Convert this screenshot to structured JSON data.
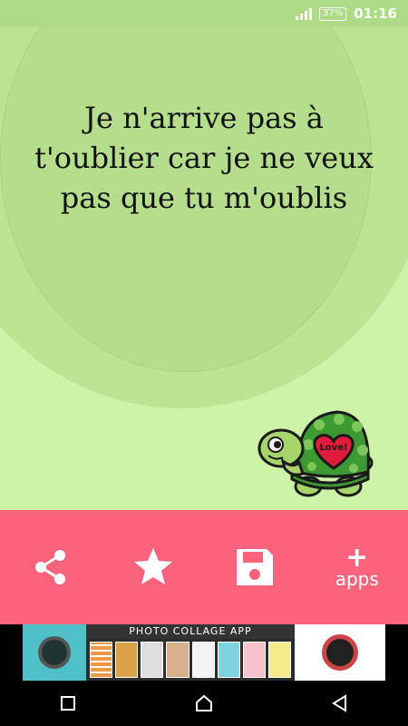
{
  "status_bar": {
    "battery": "37%",
    "time": "01:16"
  },
  "quote": {
    "text": "Je n'arrive pas à t'oublier car je ne veux pas que tu m'oublis",
    "sticker_text": "Love!"
  },
  "actions": {
    "share_icon": "share-icon",
    "favorite_icon": "star-icon",
    "save_icon": "save-icon",
    "apps_plus": "+",
    "apps_label": "apps"
  },
  "ad": {
    "title": "PHOTO COLLAGE APP"
  },
  "colors": {
    "background": "#cdf3a8",
    "action_bar": "#f9637c",
    "status_bar": "#aedb85"
  }
}
